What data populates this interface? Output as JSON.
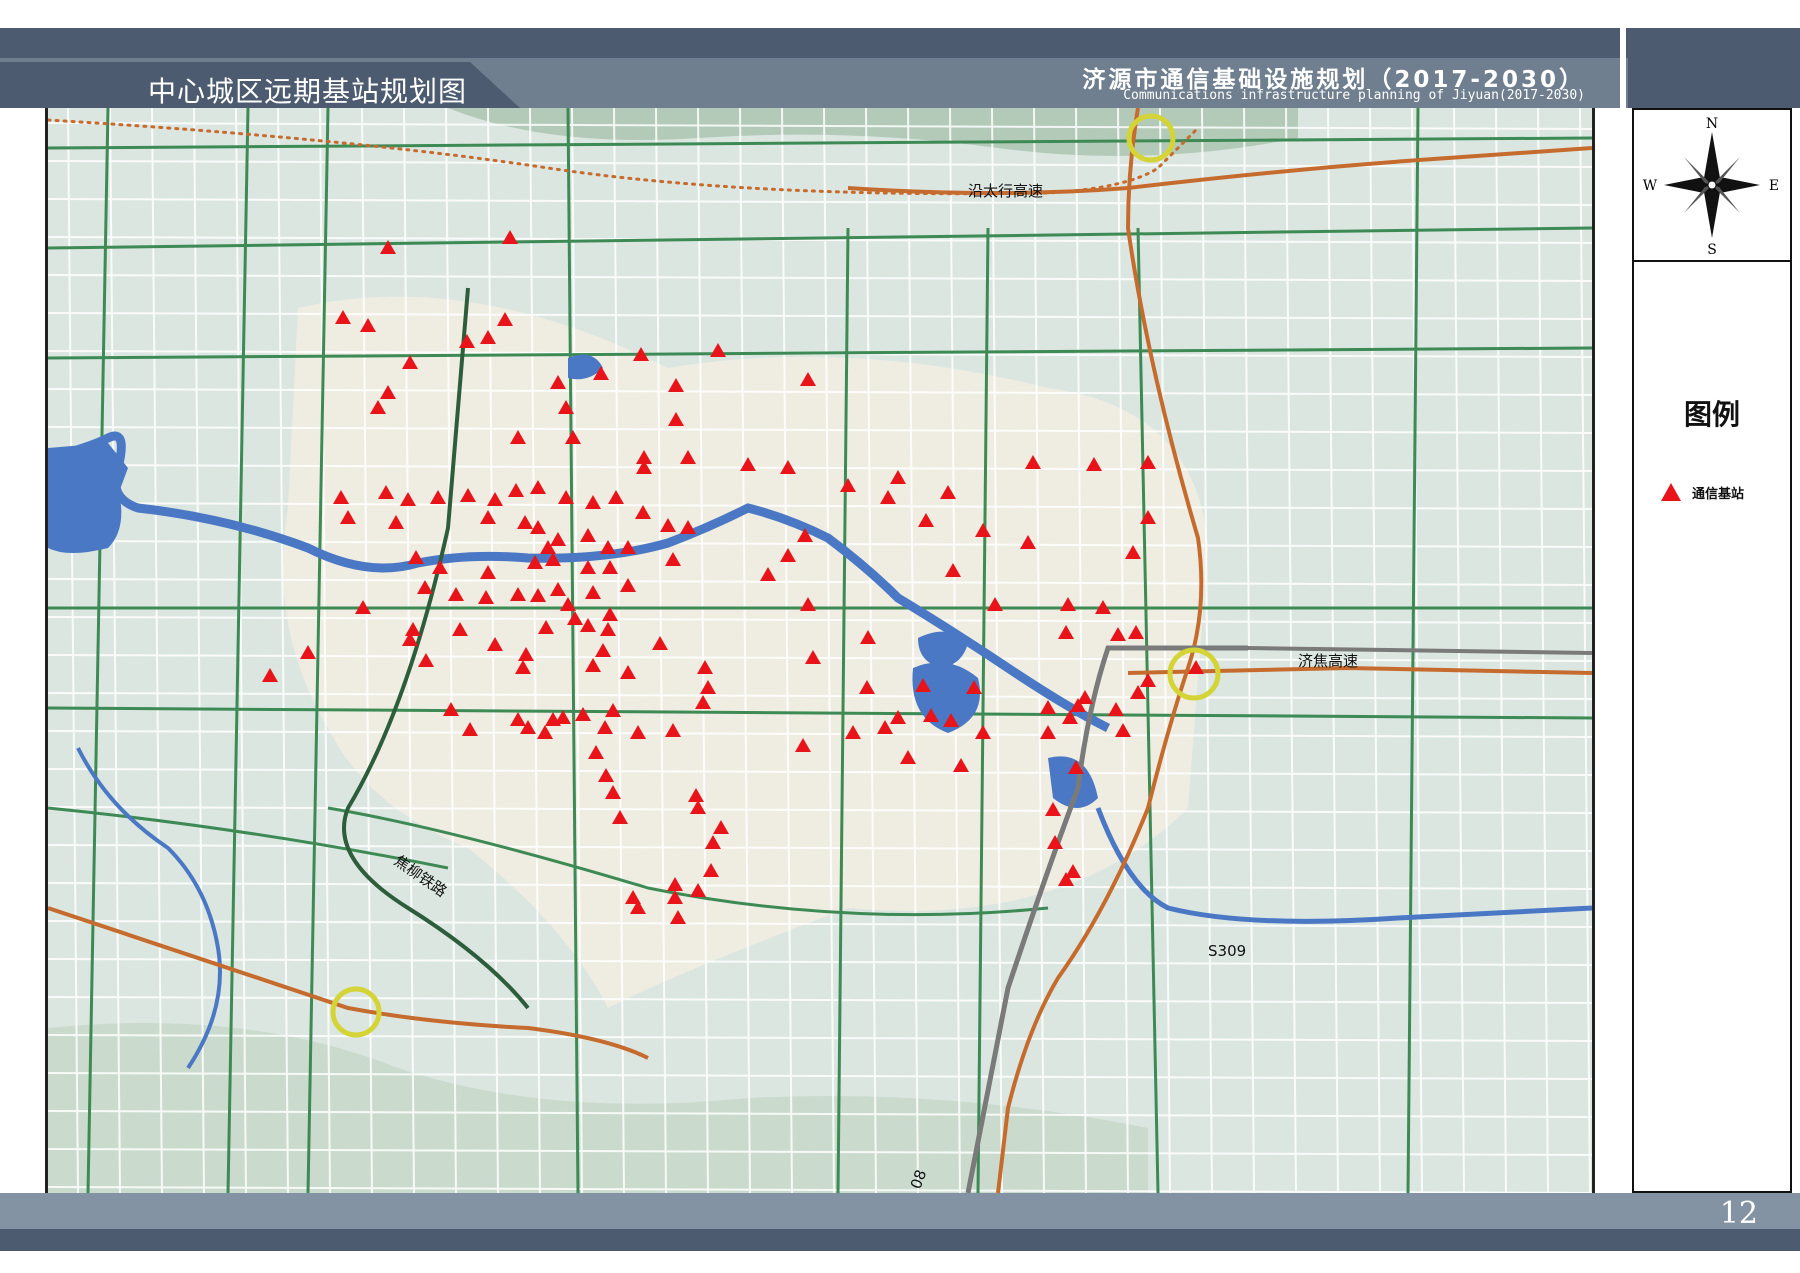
{
  "page": {
    "title": "中心城区远期基站规划图",
    "project_title": "济源市通信基础设施规划（2017-2030）",
    "project_subtitle": "Communications infrastructure planning of Jiyuan(2017-2030)",
    "page_number": "12"
  },
  "compass": {
    "n": "N",
    "s": "S",
    "e": "E",
    "w": "W"
  },
  "legend": {
    "title": "图例",
    "items": [
      {
        "label": "通信基站",
        "symbol": "red-triangle",
        "color": "#e8141a"
      }
    ]
  },
  "map": {
    "road_labels": {
      "taihang_expressway": "沿太行高速",
      "jijiao_expressway": "济焦高速",
      "jiaoliu_railway": "焦柳铁路",
      "s309": "S309",
      "g208_fragment": "08"
    },
    "colors": {
      "background": "#dbe6e1",
      "urban": "#f1ede2",
      "green_road": "#3d8a55",
      "water": "#4b78c4",
      "expressway": "#c66b2e",
      "interchange": "#d4d436",
      "railway": "#7a7a7a",
      "station": "#e8141a"
    }
  }
}
